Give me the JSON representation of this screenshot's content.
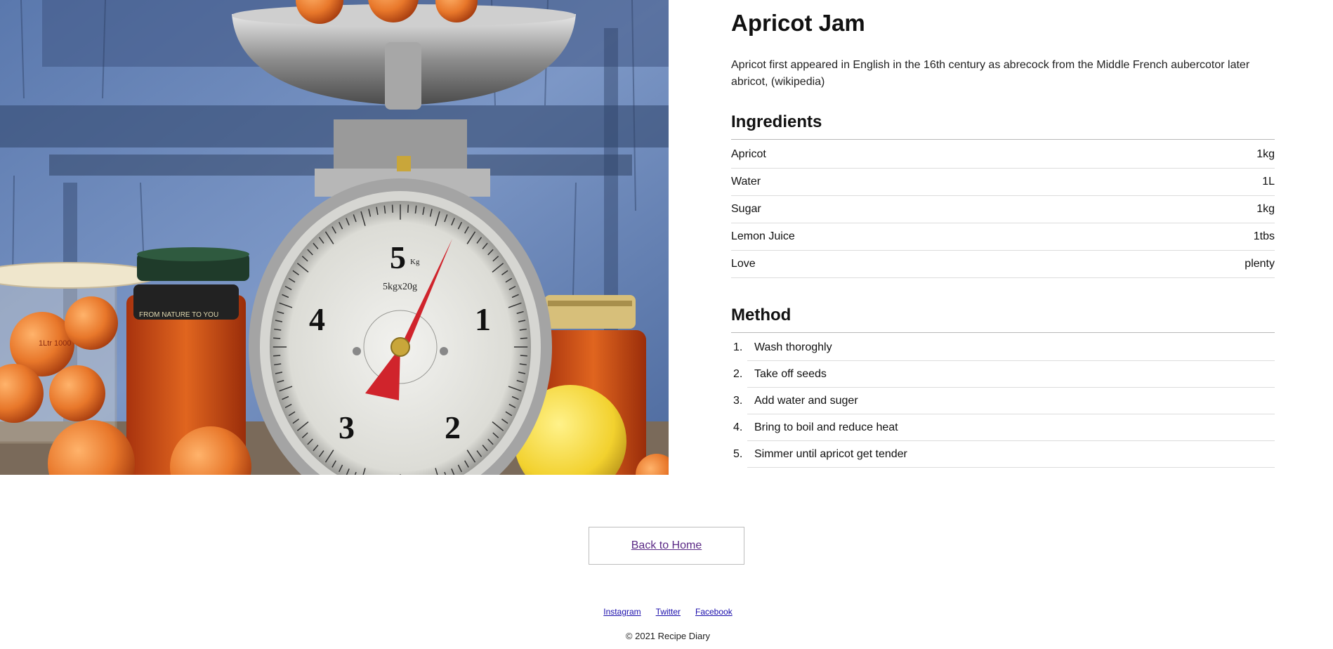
{
  "recipe": {
    "title": "Apricot Jam",
    "description": "Apricot first appeared in English in the 16th century as abrecock from the Middle French aubercotor later abricot, (wikipedia)",
    "ingredients_heading": "Ingredients",
    "ingredients": [
      {
        "name": "Apricot",
        "amount": "1kg"
      },
      {
        "name": "Water",
        "amount": "1L"
      },
      {
        "name": "Sugar",
        "amount": "1kg"
      },
      {
        "name": "Lemon Juice",
        "amount": "1tbs"
      },
      {
        "name": "Love",
        "amount": "plenty"
      }
    ],
    "method_heading": "Method",
    "steps": [
      {
        "num": "1.",
        "text": "Wash thoroghly"
      },
      {
        "num": "2.",
        "text": "Take off seeds"
      },
      {
        "num": "3.",
        "text": "Add water and suger"
      },
      {
        "num": "4.",
        "text": "Bring to boil and reduce heat"
      },
      {
        "num": "5.",
        "text": "Simmer until apricot get tender"
      }
    ]
  },
  "photo": {
    "dial_numbers": [
      "5",
      "1",
      "2",
      "3",
      "4"
    ],
    "dial_label": "5kgx20g",
    "kg_label": "Kg",
    "jar_label": "FROM NATURE TO YOU",
    "beaker_label": "1Ltr 1000",
    "colors": {
      "wall": "#6b86b8",
      "apricot": "#e8772a",
      "lemon": "#f2d12e",
      "needle": "#d0242c"
    }
  },
  "nav": {
    "back_label": "Back to Home"
  },
  "footer": {
    "links": [
      "Instagram",
      "Twitter",
      "Facebook"
    ],
    "copyright": "© 2021 Recipe Diary"
  },
  "colors": {
    "link": "#1a0dab",
    "visited_link": "#5b2a86",
    "divider": "#dcdcdc"
  }
}
